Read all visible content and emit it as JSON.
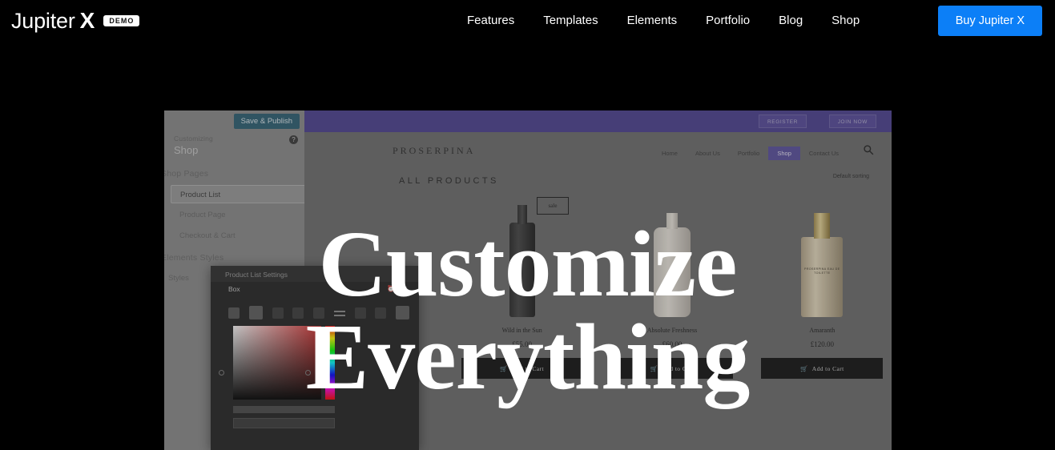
{
  "header": {
    "brand_name": "Jupiter",
    "brand_mark": "X",
    "demo_badge": "DEMO",
    "nav": [
      {
        "label": "Features"
      },
      {
        "label": "Templates"
      },
      {
        "label": "Elements"
      },
      {
        "label": "Portfolio"
      },
      {
        "label": "Blog"
      },
      {
        "label": "Shop"
      }
    ],
    "cta": {
      "label": "Buy Jupiter X",
      "color": "#0c7ff7"
    }
  },
  "hero": {
    "headline_line1": "Customize",
    "headline_line2": "Everything",
    "headline_color": "#ffffff"
  },
  "customizer": {
    "save_button": "Save & Publish",
    "customizing_label": "Customizing",
    "panel_title": "Shop",
    "help_icon": "?",
    "sections": [
      {
        "label": "Shop Pages"
      },
      {
        "label": "Elements Styles"
      }
    ],
    "items": [
      {
        "label": "Product List",
        "selected": true
      },
      {
        "label": "Product Page",
        "selected": false
      },
      {
        "label": "Checkout & Cart",
        "selected": false
      }
    ],
    "styles_item": "Styles",
    "settings_panel": {
      "title": "Product List Settings",
      "tab": "Box",
      "icons": [
        "history-icon",
        "close-icon"
      ]
    }
  },
  "preview_site": {
    "topbar_color": "#4b3f91",
    "topbar_buttons": [
      {
        "label": "REGISTER"
      },
      {
        "label": "JOIN NOW"
      }
    ],
    "brand": "PROSERPINA",
    "nav": [
      {
        "label": "Home",
        "active": false
      },
      {
        "label": "About Us",
        "active": false
      },
      {
        "label": "Portfolio",
        "active": false
      },
      {
        "label": "Shop",
        "active": true
      },
      {
        "label": "Contact Us",
        "active": false
      }
    ],
    "search_icon": "search-icon",
    "page_heading": "ALL PRODUCTS",
    "sorting": "Default sorting",
    "sale_badge": "sale",
    "products": [
      {
        "name": "Wild in the Sun",
        "price": "£55.00",
        "add_to_cart": "Add to Cart",
        "image": "dark-perfume-bottle"
      },
      {
        "name": "Absolute Freshness",
        "price": "£60.00",
        "add_to_cart": "Add to Cart",
        "image": "cream-perfume-bottle"
      },
      {
        "name": "Amaranth",
        "price": "£120.00",
        "add_to_cart": "Add to Cart",
        "image": "gold-perfume-bottle",
        "bottle_label": "PROSERPINA EAU DE TOILETTE"
      }
    ]
  }
}
